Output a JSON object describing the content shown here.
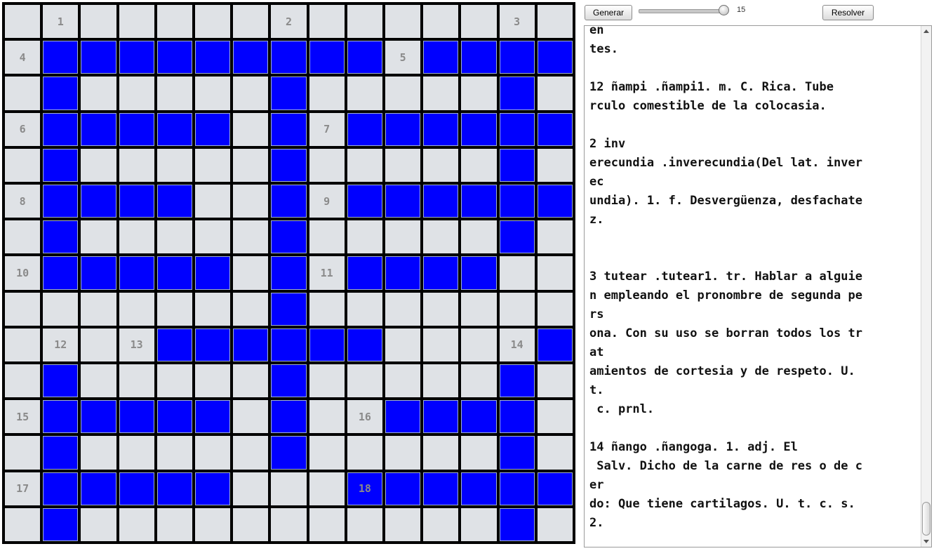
{
  "toolbar": {
    "generate_label": "Generar",
    "solve_label": "Resolver",
    "slider_value": "15",
    "slider_level": 15
  },
  "crossword": {
    "size": 15,
    "rows": [
      "...............",
      ".#########.####",
      ".#.....#.....#.",
      ".#####.#.######",
      ".#.....#.....#.",
      ".####..#.######",
      ".#.....#.....#.",
      ".#####.#.####..",
      ".......#.......",
      "....######....#",
      ".#.....#.....#.",
      ".#####.#..####.",
      ".#.....#.....#.",
      ".#####...######",
      ".#...........#."
    ],
    "numbers": [
      {
        "row": 0,
        "col": 1,
        "n": "1"
      },
      {
        "row": 0,
        "col": 7,
        "n": "2"
      },
      {
        "row": 0,
        "col": 13,
        "n": "3"
      },
      {
        "row": 1,
        "col": 0,
        "n": "4"
      },
      {
        "row": 1,
        "col": 10,
        "n": "5"
      },
      {
        "row": 3,
        "col": 0,
        "n": "6"
      },
      {
        "row": 3,
        "col": 8,
        "n": "7"
      },
      {
        "row": 5,
        "col": 0,
        "n": "8"
      },
      {
        "row": 5,
        "col": 8,
        "n": "9"
      },
      {
        "row": 7,
        "col": 0,
        "n": "10"
      },
      {
        "row": 7,
        "col": 8,
        "n": "11"
      },
      {
        "row": 9,
        "col": 1,
        "n": "12"
      },
      {
        "row": 9,
        "col": 3,
        "n": "13"
      },
      {
        "row": 9,
        "col": 13,
        "n": "14"
      },
      {
        "row": 11,
        "col": 0,
        "n": "15"
      },
      {
        "row": 11,
        "col": 9,
        "n": "16"
      },
      {
        "row": 13,
        "col": 0,
        "n": "17"
      },
      {
        "row": 13,
        "col": 9,
        "n": "18"
      }
    ]
  },
  "definitions": {
    "text": "en\ntes.\n\n12 ñampi .ñampi1. m. C. Rica. Tube\nrculo comestible de la colocasia.\n\n2 inv\nerecundia .inverecundia(Del lat. inver\nec\nundia). 1. f. Desvergüenza, desfachate\nz.\n\n\n3 tutear .tutear1. tr. Hablar a alguie\nn empleando el pronombre de segunda pe\nrs\nona. Con su uso se borran todos los tr\nat\namientos de cortesia y de respeto. U.\nt.\n c. prnl.\n\n14 ñango .ñangoga. 1. adj. El\n Salv. Dicho de la carne de res o de c\ner\ndo: Que tiene cartilagos. U. t. c. s.\n2."
  },
  "colors": {
    "filled": "#0000ff",
    "empty": "#dfe2e6",
    "grid_lines": "#000000"
  }
}
